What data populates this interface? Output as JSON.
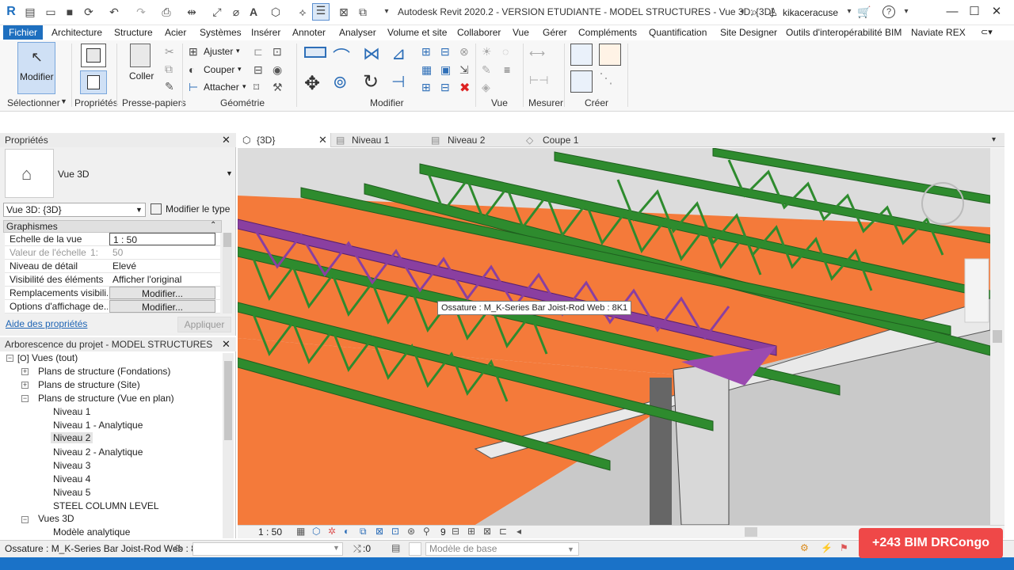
{
  "titlebar": {
    "app_title": "Autodesk Revit 2020.2 - VERSION ETUDIANTE - MODEL STRUCTURES - Vue 3D: {3D}",
    "user": "kikaceracuse",
    "help": "?"
  },
  "menu": {
    "file": "Fichier",
    "tabs": [
      "Architecture",
      "Structure",
      "Acier",
      "Systèmes",
      "Insérer",
      "Annoter",
      "Analyser",
      "Volume et site",
      "Collaborer",
      "Vue",
      "Gérer",
      "Compléments",
      "Quantification",
      "Site Designer",
      "Outils d'interopérabilité BIM",
      "Naviate REX"
    ]
  },
  "ribbon": {
    "modify_btn": "Modifier",
    "paste_btn": "Coller",
    "adjust": "Ajuster",
    "cut": "Couper",
    "attach": "Attacher",
    "groups": {
      "select": "Sélectionner",
      "properties": "Propriétés",
      "clipboard": "Presse-papiers",
      "geometry": "Géométrie",
      "modify": "Modifier",
      "view": "Vue",
      "measure": "Mesurer",
      "create": "Créer"
    }
  },
  "properties": {
    "title": "Propriétés",
    "type_name": "Vue 3D",
    "selector_value": "Vue 3D: {3D}",
    "edit_type": "Modifier le type",
    "section": "Graphismes",
    "rows": [
      {
        "name": "Echelle de la vue",
        "value": "1 : 50"
      },
      {
        "name": "Valeur de l'échelle",
        "unit": "1:",
        "value": "50"
      },
      {
        "name": "Niveau de détail",
        "value": "Elevé"
      },
      {
        "name": "Visibilité des éléments",
        "value": "Afficher l'original"
      },
      {
        "name": "Remplacements visibili...",
        "value": "Modifier..."
      },
      {
        "name": "Options d'affichage de...",
        "value": "Modifier..."
      }
    ],
    "help_link": "Aide des propriétés",
    "apply": "Appliquer"
  },
  "browser": {
    "title": "Arborescence du projet - MODEL STRUCTURES",
    "items": [
      {
        "label": "Vues (tout)",
        "sign": "−"
      },
      {
        "label": "Plans de structure (Fondations)",
        "sign": "+"
      },
      {
        "label": "Plans de structure (Site)",
        "sign": "+"
      },
      {
        "label": "Plans de structure (Vue en plan)",
        "sign": "−"
      },
      {
        "label": "Niveau 1"
      },
      {
        "label": "Niveau 1 - Analytique"
      },
      {
        "label": "Niveau 2"
      },
      {
        "label": "Niveau 2 - Analytique"
      },
      {
        "label": "Niveau 3"
      },
      {
        "label": "Niveau 4"
      },
      {
        "label": "Niveau 5"
      },
      {
        "label": "STEEL COLUMN LEVEL"
      },
      {
        "label": "Vues 3D",
        "sign": "−"
      },
      {
        "label": "Modèle analytique"
      }
    ]
  },
  "view_tabs": [
    {
      "label": "{3D}"
    },
    {
      "label": "Niveau 1"
    },
    {
      "label": "Niveau 2"
    },
    {
      "label": "Coupe 1"
    }
  ],
  "viewport": {
    "tooltip": "Ossature : M_K-Series Bar Joist-Rod Web : 8K1",
    "scale": "1 : 50",
    "detail_count": "9"
  },
  "statusbar": {
    "selection": "Ossature : M_K-Series Bar Joist-Rod Web : 8",
    "filter_count": ":0",
    "model": "Modèle de base"
  },
  "badge": "+243 BIM DRCongo",
  "colors": {
    "file_tab": "#1e6fbf",
    "joist_green": "#2e8b2e",
    "joist_selected": "#8a3fa0",
    "deck_orange": "#f47a3a",
    "badge": "#ef4848"
  }
}
